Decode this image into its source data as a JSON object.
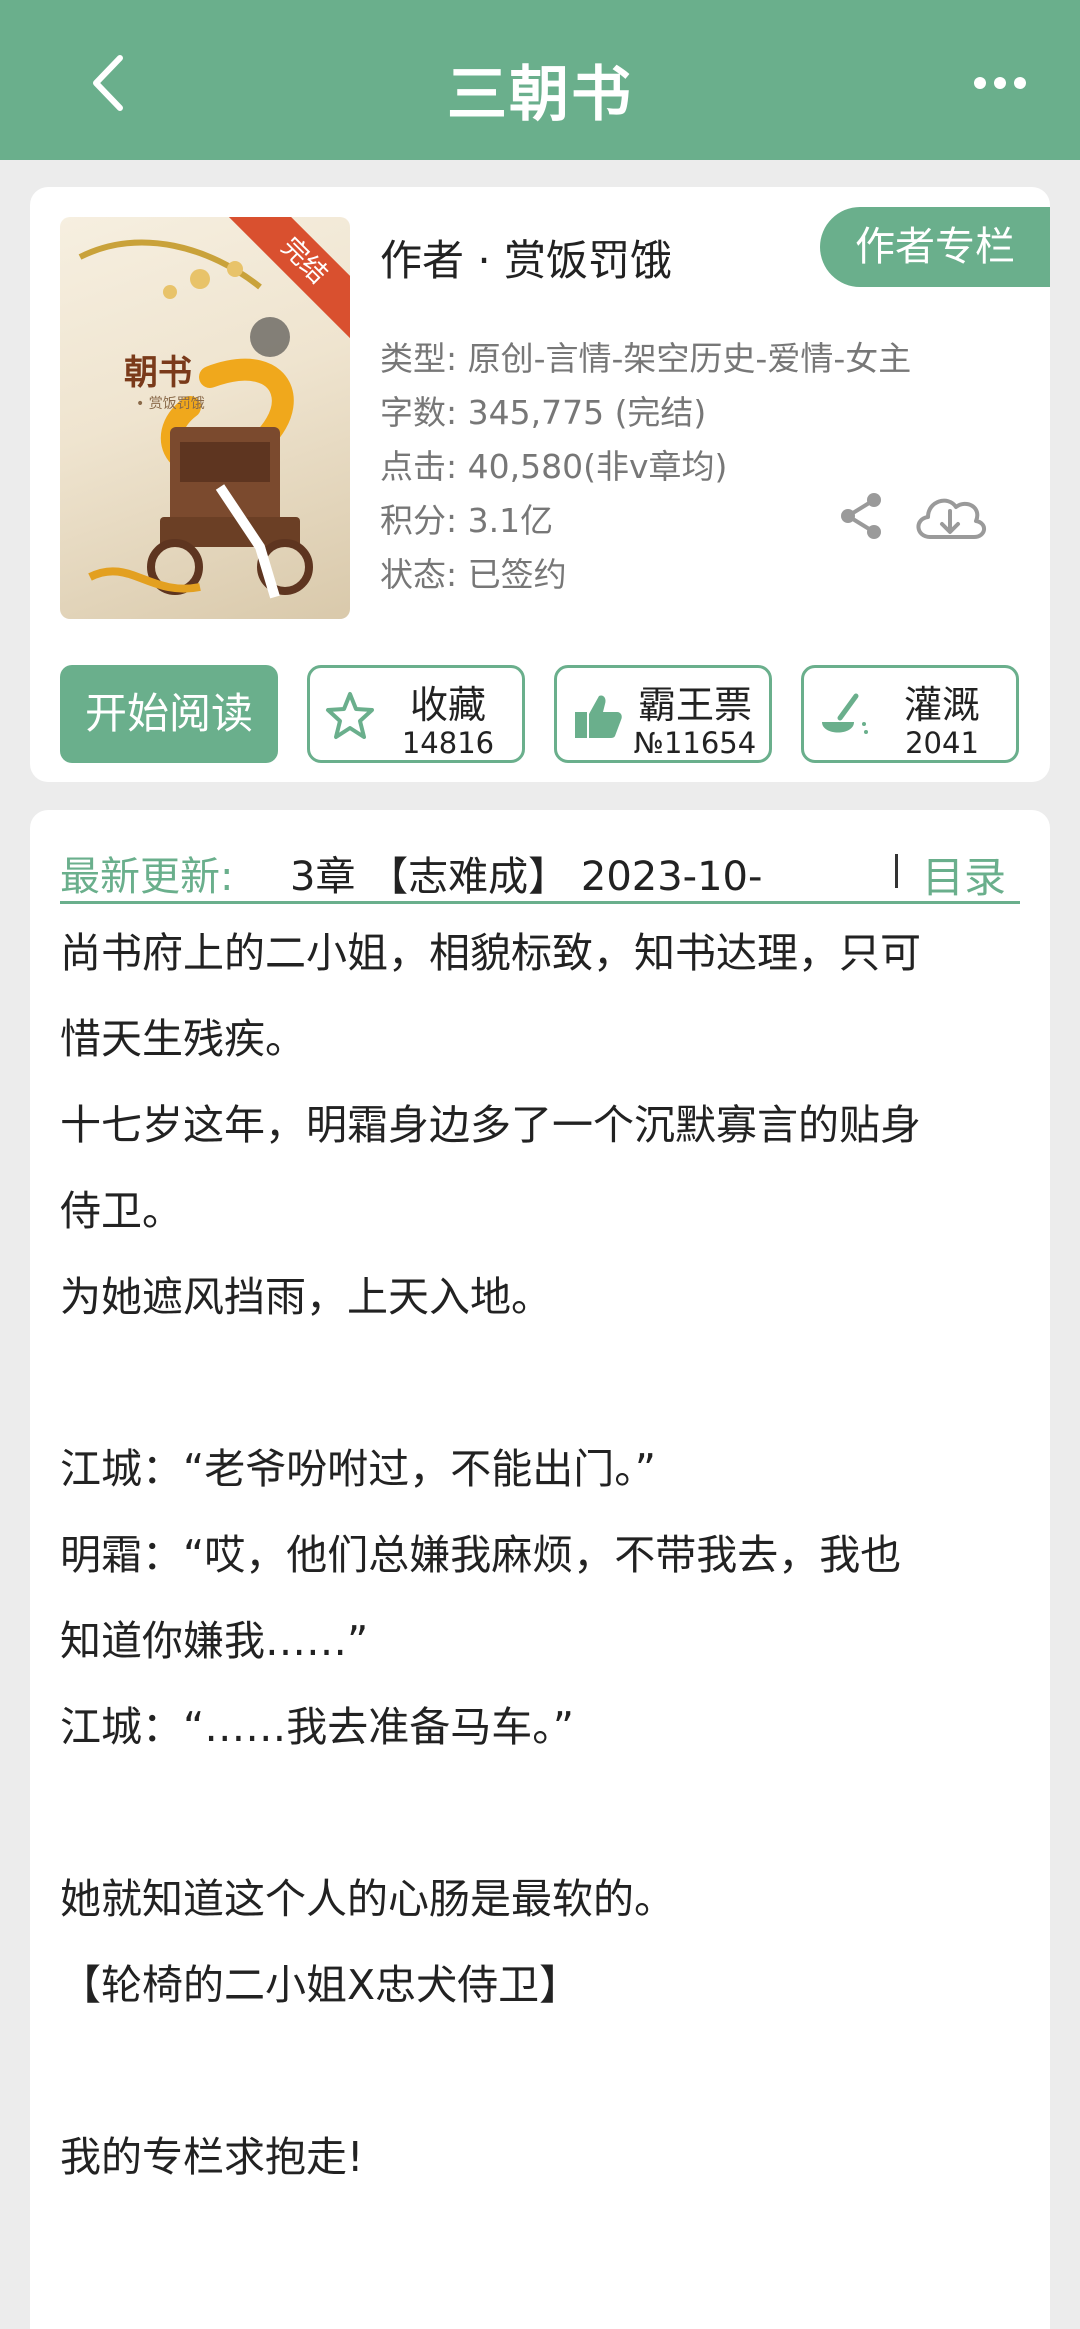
{
  "header": {
    "title": "三朝书",
    "back_icon": "chevron-left-icon",
    "more_icon": "more-horizontal-icon"
  },
  "book": {
    "cover": {
      "ribbon": "完结",
      "title": "朝书",
      "subtitle": "• 赏饭罚饿"
    },
    "author": "作者 · 赏饭罚饿",
    "author_column_label": "作者专栏",
    "meta": [
      {
        "key": "类型: ",
        "value": "原创-言情-架空历史-爱情-女主"
      },
      {
        "key": "字数: ",
        "value": "345,775 (完结)"
      },
      {
        "key": "点击: ",
        "value": "40,580(非v章均)"
      },
      {
        "key": "积分: ",
        "value": "3.1亿"
      },
      {
        "key": "状态: ",
        "value": "已签约"
      }
    ]
  },
  "actions": {
    "read_label": "开始阅读",
    "collect": {
      "label": "收藏",
      "count": "14816"
    },
    "ticket": {
      "label": "霸王票",
      "count": "№11654"
    },
    "water": {
      "label": "灌溉",
      "count": "2041"
    }
  },
  "latest": {
    "label": "最新更新:",
    "info": "3章 【志难成】 2023-10-",
    "toc_label": "目录"
  },
  "description": [
    "尚书府上的二小姐，相貌标致，知书达理，只可",
    "惜天生残疾。",
    "十七岁这年，明霜身边多了一个沉默寡言的贴身",
    "侍卫。",
    "为她遮风挡雨，上天入地。",
    "",
    "江城：“老爷吩咐过，不能出门。”",
    "明霜：“哎，他们总嫌我麻烦，不带我去，我也",
    "知道你嫌我……”",
    "江城：“……我去准备马车。”",
    "",
    "她就知道这个人的心肠是最软的。",
    "【轮椅的二小姐X忠犬侍卫】",
    "",
    "我的专栏求抱走!"
  ],
  "colors": {
    "accent": "#6aaf8c",
    "background": "#ececec"
  }
}
